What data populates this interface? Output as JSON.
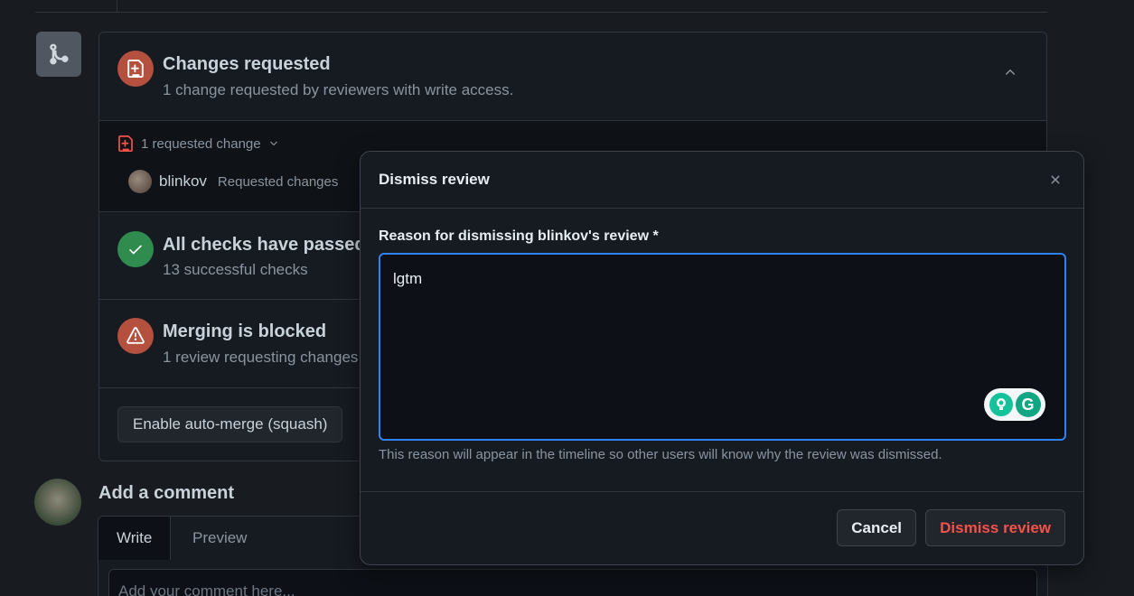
{
  "merge_box": {
    "changes": {
      "title": "Changes requested",
      "subtitle": "1 change requested by reviewers with write access."
    },
    "requested_toggle": "1 requested change",
    "reviewer": {
      "name": "blinkov",
      "state": "Requested changes"
    },
    "checks": {
      "title": "All checks have passed",
      "subtitle": "13 successful checks"
    },
    "blocked": {
      "title": "Merging is blocked",
      "subtitle": "1 review requesting changes"
    },
    "auto_merge_label": "Enable auto-merge (squash)"
  },
  "comment": {
    "heading": "Add a comment",
    "tabs": [
      "Write",
      "Preview"
    ],
    "placeholder": "Add your comment here..."
  },
  "dialog": {
    "title": "Dismiss review",
    "reason_label": "Reason for dismissing blinkov's review *",
    "reason_value": "lgtm",
    "hint": "This reason will appear in the timeline so other users will know why the review was dismissed.",
    "cancel_label": "Cancel",
    "dismiss_label": "Dismiss review"
  },
  "colors": {
    "danger": "#f85149",
    "success": "#2f8b4e",
    "focus": "#2f81f7",
    "grammarly": "#15c39a"
  },
  "icons": [
    "merge-icon",
    "file-diff-icon",
    "chevron-up-icon",
    "chevron-down-icon",
    "check-icon",
    "alert-icon",
    "close-icon",
    "grammarly-icon"
  ]
}
